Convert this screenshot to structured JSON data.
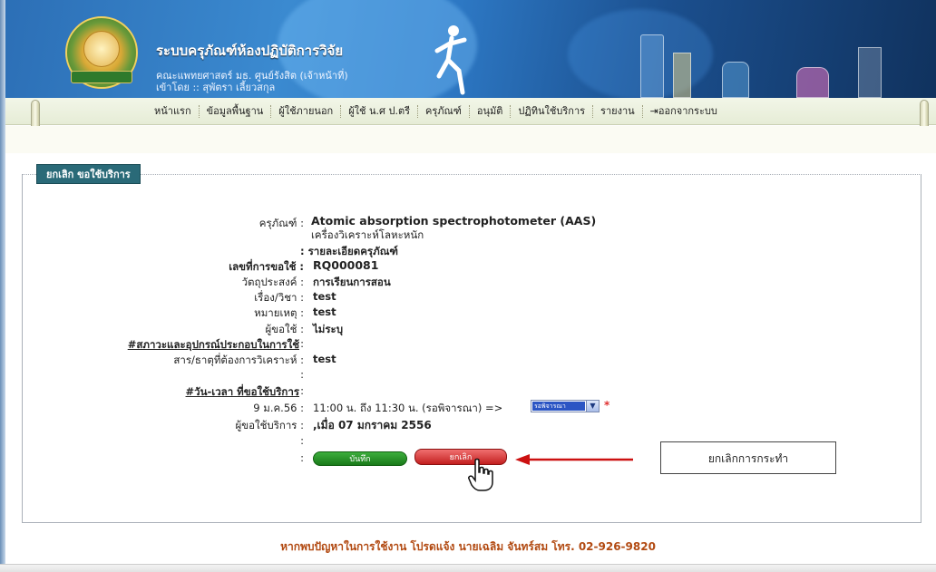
{
  "header": {
    "title": "ระบบครุภัณฑ์ห้องปฏิบัติการวิจัย",
    "subtitle": "คณะแพทยศาสตร์ มธ. ศูนย์รังสิต (เจ้าหน้าที่)",
    "login_line": "เข้าโดย :: สุพัตรา เลี้ยวสกุล",
    "logo_icon": "university-seal-icon"
  },
  "nav": {
    "items": [
      "หน้าแรก",
      "ข้อมูลพื้นฐาน",
      "ผู้ใช้ภายนอก",
      "ผู้ใช้ น.ศ ป.ตรี",
      "ครุภัณฑ์",
      "อนุมัติ",
      "ปฏิทินใช้บริการ",
      "รายงาน",
      "ออกจากระบบ"
    ]
  },
  "section": {
    "title": "ยกเลิก ขอใช้บริการ"
  },
  "form": {
    "equipment_label": "ครุภัณฑ์ :",
    "equipment_name": "Atomic absorption spectrophotometer (AAS)",
    "equipment_thai": "เครื่องวิเคราะห์โลหะหนัก",
    "detail_link": ": รายละเอียดครุภัณฑ์",
    "request_no_label": "เลขที่การขอใช้ :",
    "request_no": "RQ000081",
    "purpose_label": "วัตถุประสงค์ :",
    "purpose": "การเรียนการสอน",
    "subject_label": "เรื่อง/วิชา :",
    "subject": "test",
    "note_label": "หมายเหตุ :",
    "note": "test",
    "user_label": "ผู้ขอใช้ :",
    "user": "ไม่ระบุ",
    "conditions_heading": "#สภาวะและอุปกรณ์ประกอบในการใช้",
    "conditions_colon": ":",
    "substance_label": "สาร/ธาตุที่ต้องการวิเคราะห์ :",
    "substance": "test",
    "blank_colon_1": ":",
    "datetime_heading": "#วัน-เวลา ที่ขอใช้บริการ",
    "datetime_colon": ":",
    "date_label": "9 ม.ค.56 :",
    "time_text": "11:00 น. ถึง 11:30 น. (รอพิจารณา) =>",
    "status_selected": "รอพิจารณา",
    "required_mark": "*",
    "requester_label": "ผู้ขอใช้บริการ :",
    "requester": ",เมื่อ 07 มกราคม 2556",
    "blank_colon_2": ":",
    "buttons_colon": ":"
  },
  "buttons": {
    "save": "บันทึก",
    "cancel": "ยกเลิก"
  },
  "annotation": {
    "callout": "ยกเลิกการกระทำ"
  },
  "footer": {
    "text": "หากพบปัญหาในการใช้งาน โปรดแจ้ง นายเฉลิม จันทร์สม โทร. 02-926-9820"
  },
  "colors": {
    "header_blue": "#2c6fb6",
    "section_tab": "#2a6a78",
    "save_green": "#1a7a1a",
    "cancel_red": "#c31f1f",
    "footer_text": "#b24a12",
    "arrow_red": "#cc1111"
  }
}
